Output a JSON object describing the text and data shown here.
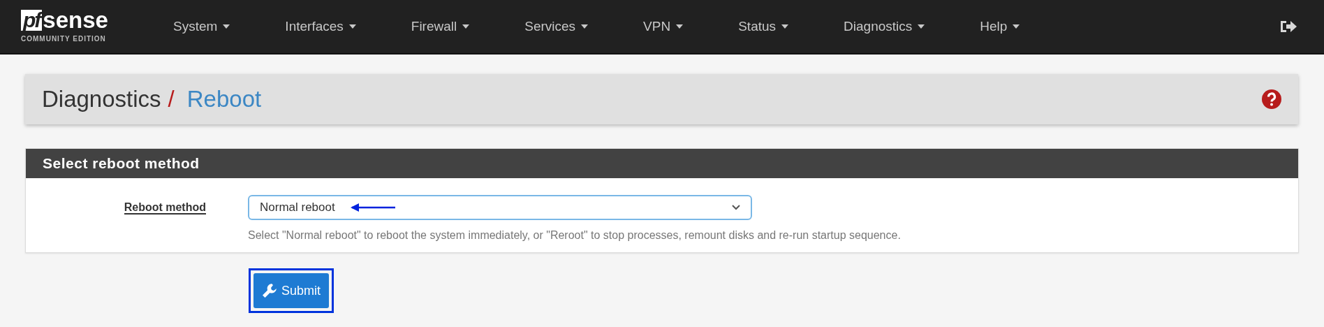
{
  "navbar": {
    "logo": {
      "mark": "pf",
      "word": "sense",
      "edition": "COMMUNITY EDITION"
    },
    "menu": [
      {
        "label": "System"
      },
      {
        "label": "Interfaces"
      },
      {
        "label": "Firewall"
      },
      {
        "label": "Services"
      },
      {
        "label": "VPN"
      },
      {
        "label": "Status"
      },
      {
        "label": "Diagnostics"
      },
      {
        "label": "Help"
      }
    ]
  },
  "breadcrumb": {
    "section": "Diagnostics",
    "separator": "/",
    "page": "Reboot"
  },
  "panel": {
    "title": "Select reboot method",
    "field": {
      "label": "Reboot method",
      "value": "Normal reboot",
      "help": "Select \"Normal reboot\" to reboot the system immediately, or \"Reroot\" to stop processes, remount disks and re-run startup sequence."
    }
  },
  "submit": {
    "label": "Submit",
    "highlighted": true
  },
  "annotations": {
    "arrow_to_select": true
  }
}
